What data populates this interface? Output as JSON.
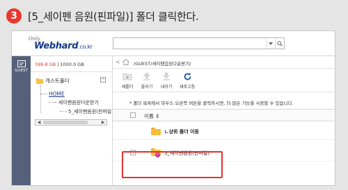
{
  "step": {
    "number": "3",
    "instruction": "[5_세이펜 음원(핀파일)] 폴더 클릭한다."
  },
  "brand": {
    "tagline": "Only",
    "name": "Webhard",
    "tld": ".co.kr"
  },
  "search": {
    "value": "",
    "placeholder": ""
  },
  "leftrail": {
    "guest_label": "GUEST"
  },
  "storage": {
    "used": "399.8 GB",
    "total": "1000.0 GB"
  },
  "tree": {
    "root": "게스트폴더",
    "collapse_symbol": "−",
    "home": "HOME",
    "child": "세이펜음원다운받기",
    "grandchild": "5_세이펜음원(핀파일)"
  },
  "path": {
    "back": "<",
    "text": "/GUEST/세이펜음원다운받기/"
  },
  "toolbar": {
    "items": [
      {
        "label": "새폴더",
        "icon": "new-folder-icon"
      },
      {
        "label": "올리기",
        "icon": "upload-icon"
      },
      {
        "label": "내리기",
        "icon": "download-icon"
      },
      {
        "label": "새로고침",
        "icon": "refresh-icon"
      }
    ]
  },
  "notice": "* 폴더 목록에서 마우스 오른쪽 버튼을 클릭하시면, 더 많은 기능을 사용할 수 있습니다.",
  "table": {
    "header_name": "이름 ⇕",
    "rows": [
      {
        "label": "ㄴ상위 폴더 이동",
        "bold": true,
        "has_checkbox": false
      },
      {
        "label": "5_세이펜음원(핀파일)",
        "bold": false,
        "has_checkbox": true,
        "badge": "s"
      }
    ]
  },
  "colors": {
    "accent": "#e8372b",
    "rail": "#55617a",
    "folder": "#f5bf3b",
    "highlight": "#e0322b"
  }
}
